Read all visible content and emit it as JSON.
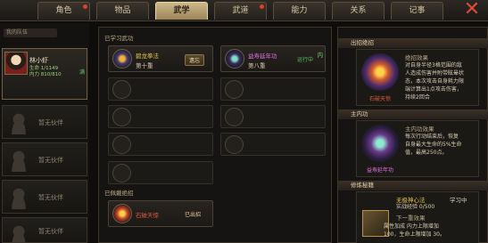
{
  "tabs": [
    {
      "label": "角色",
      "dot": true
    },
    {
      "label": "物品",
      "dot": false
    },
    {
      "label": "武学",
      "dot": false,
      "active": true
    },
    {
      "label": "武道",
      "dot": true
    },
    {
      "label": "能力",
      "dot": false
    },
    {
      "label": "关系",
      "dot": false
    },
    {
      "label": "记事",
      "dot": false
    }
  ],
  "close_glyph": "✕",
  "team": {
    "caption": "我的队伍",
    "hero": {
      "name": "林小虾",
      "hp": "生命 1/1149",
      "mp": "内力 810/810",
      "state": "满"
    },
    "empty_label": "暂无伙伴"
  },
  "skills": {
    "learned_title": "已学习武功",
    "active": [
      {
        "name": "碧龙拳法",
        "level": "第十重",
        "button": "遗忘",
        "name_color": "#e6c34a"
      },
      {
        "name": "益寿延年功",
        "level": "第八重",
        "status": "运行中",
        "side": "内",
        "name_color": "#e070e0"
      }
    ],
    "equipped_title": "已佩戴绝招",
    "trick": {
      "name": "石破天惊",
      "status": "已出招",
      "name_color": "#e05a3a"
    }
  },
  "detail": {
    "trick_header": "出招绝招",
    "trick_effect_title": "绝招效果",
    "trick_effect_text": [
      "对自身半径3格范围的敌",
      "人造成伤害并附带眩晕状",
      "态，本次攻击自身耗力限",
      "端计算出1点攻击伤害，",
      "持续2回合"
    ],
    "trick_name": "石破天惊",
    "inner_header": "主内功",
    "inner_effect_title": "主内功效果",
    "inner_effect_text": [
      "每次行动结束后，恢复",
      "自身最大生命的5%生命",
      "值，最高250点。"
    ],
    "inner_name": "益寿延年功",
    "manual_header": "修炼秘籍",
    "manual_name": "无极神心法",
    "manual_state": "学习中",
    "manual_progress": "实战经验 0/500",
    "manual_next": "下一重效果",
    "manual_next_text": [
      "属性加成 内力上限增加",
      "100，生命上限增加 30。"
    ]
  }
}
